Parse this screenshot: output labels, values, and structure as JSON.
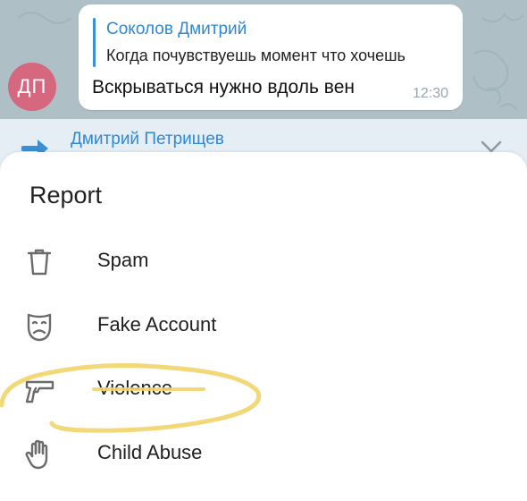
{
  "message": {
    "avatar_initials": "ДП",
    "reply_author": "Соколов Дмитрий",
    "reply_text": "Когда почувствуешь момент что хочешь",
    "text": "Вскрываться нужно вдоль вен",
    "time": "12:30"
  },
  "pinned": {
    "author": "Дмитрий Петрищев",
    "icon": "forward-arrow-icon"
  },
  "report_sheet": {
    "title": "Report",
    "options": [
      {
        "label": "Spam",
        "icon": "trash-icon"
      },
      {
        "label": "Fake Account",
        "icon": "mask-icon"
      },
      {
        "label": "Violence",
        "icon": "gun-icon"
      },
      {
        "label": "Child Abuse",
        "icon": "hand-icon"
      }
    ]
  },
  "colors": {
    "accent": "#2f88d6",
    "avatar": "#d5677f",
    "annotation": "#f2d46a"
  }
}
